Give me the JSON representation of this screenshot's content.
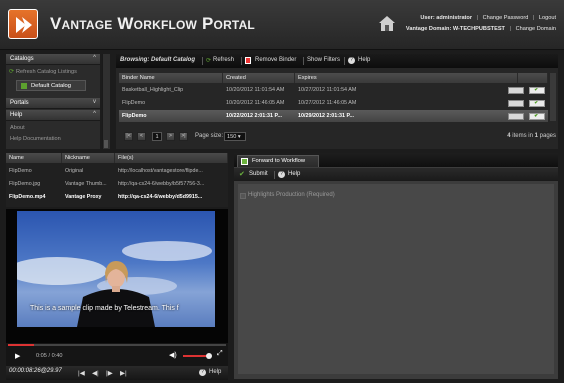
{
  "header": {
    "title": "Vantage Workflow Portal",
    "user_label": "User:",
    "user_name": "administrator",
    "change_password": "Change Password",
    "logout": "Logout",
    "domain_label": "Vantage Domain:",
    "domain_name": "W-TECHPUBSTEST",
    "change_domain": "Change Domain"
  },
  "sidebar": {
    "catalogs_header": "Catalogs",
    "refresh_catalogs": "Refresh Catalog Listings",
    "default_catalog": "Default Catalog",
    "portals_header": "Portals",
    "help_header": "Help",
    "about": "About",
    "help_docs": "Help Documentation"
  },
  "browse": {
    "title": "Browsing: Default Catalog",
    "refresh": "Refresh",
    "remove_binder": "Remove Binder",
    "show_filters": "Show Filters",
    "help": "Help",
    "columns": [
      "Binder Name",
      "Created",
      "Expires"
    ],
    "rows": [
      {
        "name": "Basketball_Highlight_Clip",
        "created": "10/20/2012 11:01:54 AM",
        "expires": "10/27/2012 11:01:54 AM"
      },
      {
        "name": "FlipDemo",
        "created": "10/20/2012 11:46:05 AM",
        "expires": "10/27/2012 11:46:05 AM"
      },
      {
        "name": "FlipDemo",
        "created": "10/22/2012 2:01:31 P...",
        "expires": "10/29/2012 2:01:31 P..."
      }
    ],
    "page_number": "1",
    "page_size_label": "Page size:",
    "page_size": "150",
    "items_count": "4",
    "items_text": "items in",
    "pages_count": "1",
    "pages_text": "pages"
  },
  "files": {
    "columns": [
      "Name",
      "Nickname",
      "File(s)"
    ],
    "rows": [
      {
        "name": "FlipDemo",
        "nickname": "Original",
        "file": "http://localhost/vantagestore/flipde..."
      },
      {
        "name": "FlipDemo.jpg",
        "nickname": "Vantage Thumb...",
        "file": "http://qa-cs24-6/webby/b5f57756-3..."
      },
      {
        "name": "FlipDemo.mp4",
        "nickname": "Vantage Proxy",
        "file": "http://qa-cs24-6/webby/d5d9915..."
      }
    ]
  },
  "player": {
    "caption": "This is a sample clip made by Telestream. This f",
    "current_time": "0:05",
    "time_sep": "/",
    "duration": "0:40",
    "timecode": "00:00:08:26@29.97",
    "help": "Help",
    "progress_fraction": 0.12
  },
  "workflow": {
    "tab_label": "Forward to Workflow",
    "submit": "Submit",
    "help": "Help",
    "highlights_label": "Highlights Production (Required)"
  },
  "colors": {
    "accent_orange": "#d9621f",
    "green": "#5ca02e"
  }
}
